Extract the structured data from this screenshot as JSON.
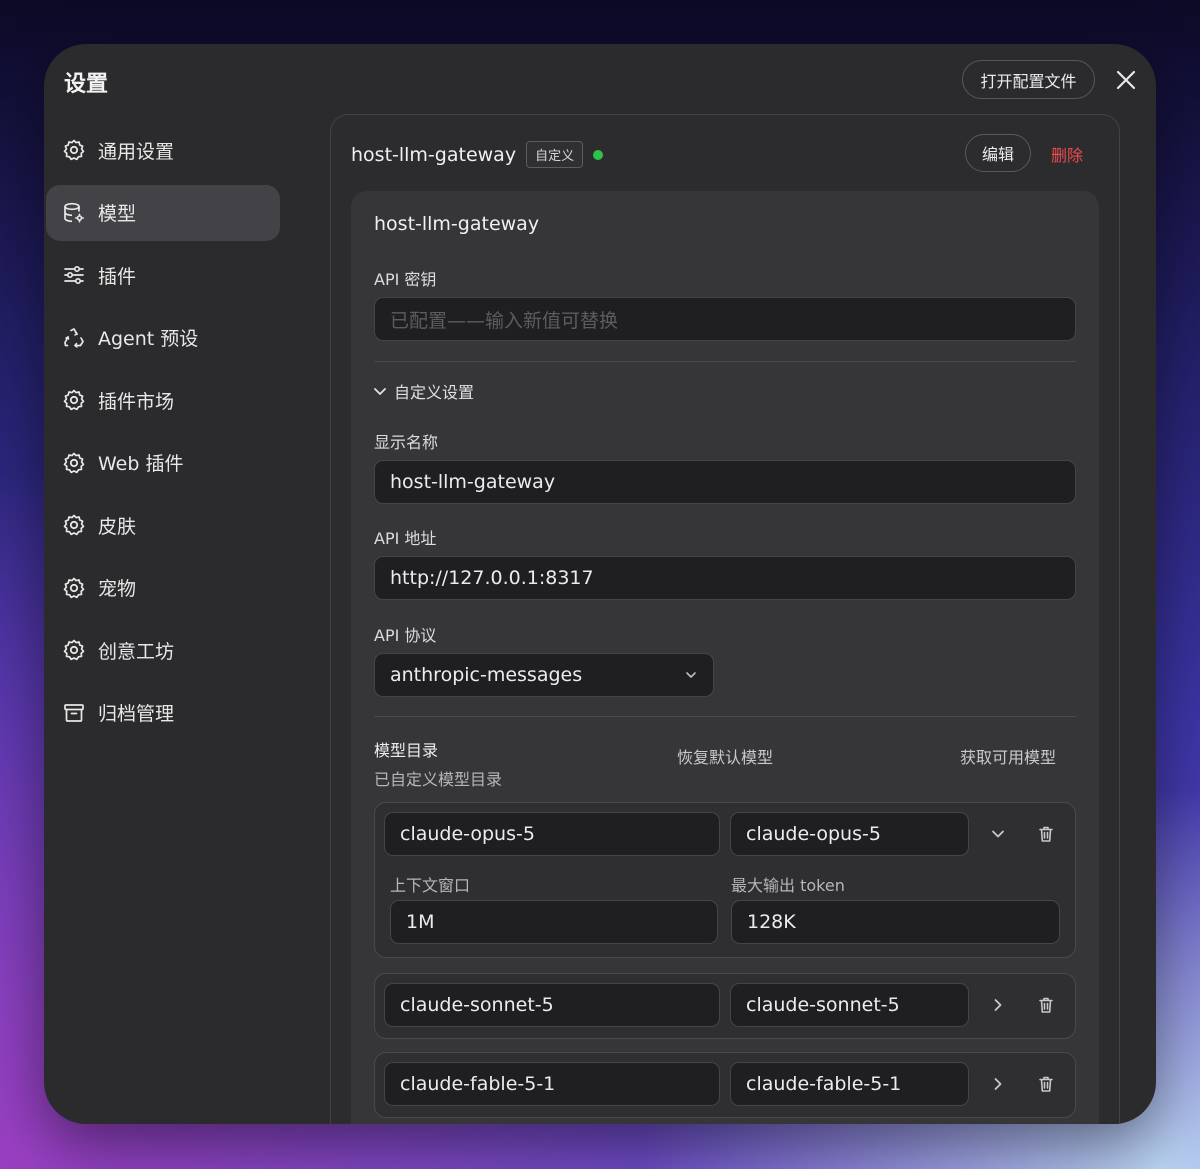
{
  "window": {
    "title": "设置",
    "open_config_label": "打开配置文件"
  },
  "sidebar": {
    "items": [
      {
        "label": "通用设置",
        "icon": "gear-icon"
      },
      {
        "label": "模型",
        "icon": "database-gear-icon",
        "active": true
      },
      {
        "label": "插件",
        "icon": "sliders-icon"
      },
      {
        "label": "Agent 预设",
        "icon": "recycle-icon"
      },
      {
        "label": "插件市场",
        "icon": "gear-icon"
      },
      {
        "label": "Web 插件",
        "icon": "gear-icon"
      },
      {
        "label": "皮肤",
        "icon": "gear-icon"
      },
      {
        "label": "宠物",
        "icon": "gear-icon"
      },
      {
        "label": "创意工坊",
        "icon": "gear-icon"
      },
      {
        "label": "归档管理",
        "icon": "archive-icon"
      }
    ]
  },
  "provider": {
    "name": "host-llm-gateway",
    "badge": "自定义",
    "status_color": "#2ec24a",
    "edit_label": "编辑",
    "delete_label": "删除",
    "card_title": "host-llm-gateway",
    "api_key_label": "API 密钥",
    "api_key_placeholder": "已配置——输入新值可替换",
    "custom_section_label": "自定义设置",
    "display_name_label": "显示名称",
    "display_name_value": "host-llm-gateway",
    "api_url_label": "API 地址",
    "api_url_value": "http://127.0.0.1:8317",
    "api_protocol_label": "API 协议",
    "api_protocol_value": "anthropic-messages",
    "catalog_label": "模型目录",
    "catalog_sub": "已自定义模型目录",
    "restore_label": "恢复默认模型",
    "fetch_label": "获取可用模型",
    "models": [
      {
        "id": "claude-opus-5",
        "name": "claude-opus-5",
        "expanded": true,
        "context_label": "上下文窗口",
        "context_value": "1M",
        "max_output_label": "最大输出 token",
        "max_output_value": "128K"
      },
      {
        "id": "claude-sonnet-5",
        "name": "claude-sonnet-5",
        "expanded": false
      },
      {
        "id": "claude-fable-5-1",
        "name": "claude-fable-5-1",
        "expanded": false
      }
    ]
  }
}
